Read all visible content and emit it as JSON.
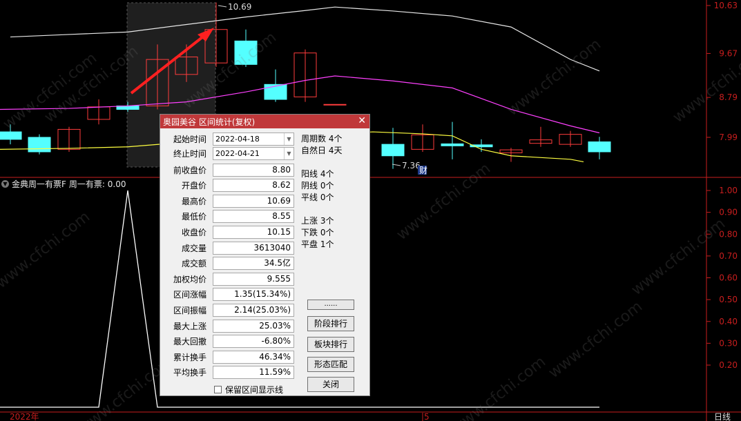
{
  "main_chart": {
    "price_ticks": [
      "10.63",
      "9.67",
      "8.79",
      "7.99"
    ],
    "high_marker": "10.69",
    "low_marker": "7.36",
    "cai_badge": "财"
  },
  "indicator": {
    "title": "金典周一有票F",
    "value_label": "周一有票: 0.00",
    "ticks": [
      "1.00",
      "0.90",
      "0.80",
      "0.70",
      "0.60",
      "0.50",
      "0.40",
      "0.30",
      "0.20"
    ]
  },
  "bottom_axis": {
    "year_label": "2022年",
    "mid_label": "5",
    "period_label": "日线"
  },
  "watermark_text": "www.cfchi.com",
  "colors": {
    "up_candle": "#ff3c3c",
    "down_candle": "#54ffff",
    "ma_white": "#e8e8e8",
    "ma_magenta": "#ff40ff",
    "ma_yellow": "#ffff40",
    "axis_red": "#c81e1e",
    "dialog_title_bg": "#c0383a"
  },
  "dialog": {
    "title": "奥园美谷 区间统计(复权)",
    "start_label": "起始时间",
    "start_value": "2022-04-18",
    "end_label": "终止时间",
    "end_value": "2022-04-21",
    "fields": [
      {
        "label": "前收盘价",
        "value": "8.80"
      },
      {
        "label": "开盘价",
        "value": "8.62"
      },
      {
        "label": "最高价",
        "value": "10.69"
      },
      {
        "label": "最低价",
        "value": "8.55"
      },
      {
        "label": "收盘价",
        "value": "10.15"
      },
      {
        "label": "成交量",
        "value": "3613040"
      },
      {
        "label": "成交额",
        "value": "34.5亿"
      },
      {
        "label": "加权均价",
        "value": "9.555"
      },
      {
        "label": "区间涨幅",
        "value": "1.35(15.34%)"
      },
      {
        "label": "区间振幅",
        "value": "2.14(25.03%)"
      },
      {
        "label": "最大上涨",
        "value": "25.03%"
      },
      {
        "label": "最大回撤",
        "value": "-6.80%"
      },
      {
        "label": "累计换手",
        "value": "46.34%"
      },
      {
        "label": "平均换手",
        "value": "11.59%"
      }
    ],
    "stats": [
      "周期数 4个",
      "自然日 4天",
      "阳线 4个",
      "阴线 0个",
      "平线 0个",
      "上涨 3个",
      "下跌 0个",
      "平盘 1个"
    ],
    "buttons": [
      "......",
      "阶段排行",
      "板块排行",
      "形态匹配",
      "关闭"
    ],
    "keep_line_label": "保留区间显示线"
  }
}
